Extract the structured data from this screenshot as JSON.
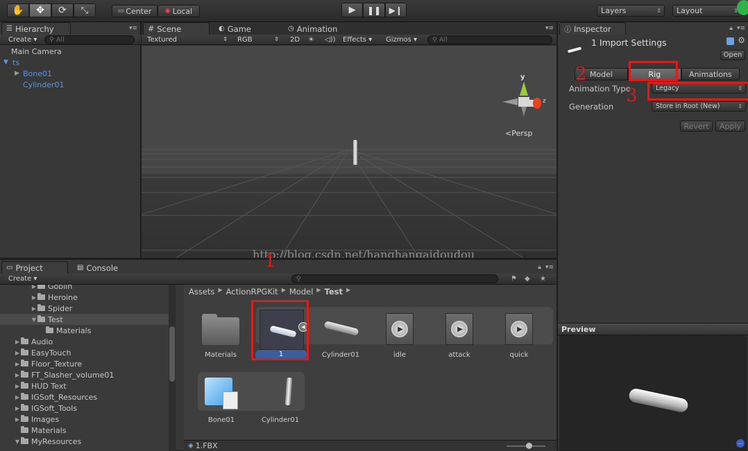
{
  "toolbar": {
    "tool_icons": [
      "hand-icon",
      "move-icon",
      "rotate-icon",
      "scale-icon"
    ],
    "pivot_label": "Center",
    "space_label": "Local",
    "layers_label": "Layers",
    "layout_label": "Layout"
  },
  "hierarchy": {
    "tab": "Hierarchy",
    "create": "Create",
    "search_placeholder": "All",
    "items": [
      "Main Camera",
      "ts",
      "Bone01",
      "Cylinder01"
    ]
  },
  "scene": {
    "tabs": [
      "Scene",
      "Game",
      "Animation"
    ],
    "shading": "Textured",
    "render_mode": "RGB",
    "mode_2d": "2D",
    "effects": "Effects",
    "gizmos": "Gizmos",
    "search_placeholder": "All",
    "persp_label": "Persp",
    "axis_y": "y",
    "axis_z": "z",
    "watermark": "http://blog.csdn.net/hanghangaidoudou"
  },
  "inspector": {
    "tab": "Inspector",
    "title": "1 Import Settings",
    "open_label": "Open",
    "tabs": [
      "Model",
      "Rig",
      "Animations"
    ],
    "animation_type_label": "Animation Type",
    "animation_type_value": "Legacy",
    "generation_label": "Generation",
    "generation_value": "Store in Root (New)",
    "revert_label": "Revert",
    "apply_label": "Apply",
    "preview_label": "Preview"
  },
  "project": {
    "tabs": [
      "Project",
      "Console"
    ],
    "create": "Create",
    "tree": [
      {
        "label": "Goblin",
        "indent": 3,
        "expanded": false
      },
      {
        "label": "Heroine",
        "indent": 3,
        "expanded": false
      },
      {
        "label": "Spider",
        "indent": 3,
        "expanded": false
      },
      {
        "label": "Test",
        "indent": 3,
        "expanded": true
      },
      {
        "label": "Materials",
        "indent": 4,
        "expanded": null
      },
      {
        "label": "Audio",
        "indent": 1,
        "expanded": false
      },
      {
        "label": "EasyTouch",
        "indent": 1,
        "expanded": false
      },
      {
        "label": "Floor_Texture",
        "indent": 1,
        "expanded": false
      },
      {
        "label": "FT_Slasher_volume01",
        "indent": 1,
        "expanded": false
      },
      {
        "label": "HUD Text",
        "indent": 1,
        "expanded": false
      },
      {
        "label": "IGSoft_Resources",
        "indent": 1,
        "expanded": false
      },
      {
        "label": "IGSoft_Tools",
        "indent": 1,
        "expanded": false
      },
      {
        "label": "Images",
        "indent": 1,
        "expanded": false
      },
      {
        "label": "Materials",
        "indent": 1,
        "expanded": null
      },
      {
        "label": "MyResources",
        "indent": 1,
        "expanded": true
      }
    ],
    "breadcrumb": [
      "Assets",
      "ActionRPGKit",
      "Model",
      "Test"
    ],
    "assets_row1": [
      "Materials",
      "1",
      "Cylinder01",
      "idle",
      "attack",
      "quick"
    ],
    "assets_row2": [
      "Bone01",
      "Cylinder01"
    ],
    "selected_file": "1.FBX"
  },
  "annotations": [
    "1",
    "2",
    "3"
  ]
}
